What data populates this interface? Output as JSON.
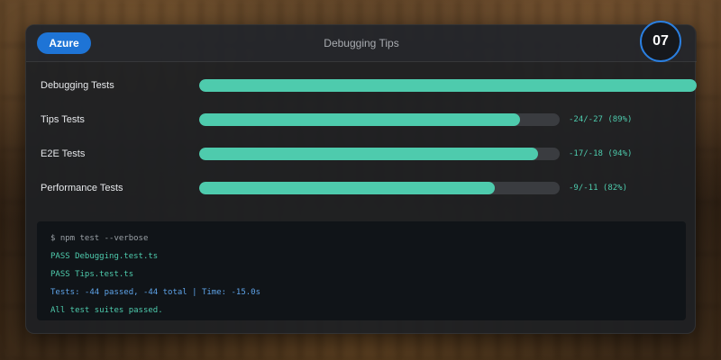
{
  "header": {
    "badge": "Azure",
    "title": "Debugging Tips",
    "step": "07"
  },
  "rows": [
    {
      "label": "Debugging Tests",
      "progress": 1.0,
      "stat": ""
    },
    {
      "label": "Tips Tests",
      "progress": 0.89,
      "stat": "-24/-27 (89%)"
    },
    {
      "label": "E2E Tests",
      "progress": 0.94,
      "stat": "-17/-18 (94%)"
    },
    {
      "label": "Performance Tests",
      "progress": 0.82,
      "stat": "-9/-11 (82%)"
    }
  ],
  "terminal": {
    "lines": [
      {
        "text": "$ npm test --verbose",
        "kind": "cmd"
      },
      {
        "text": "PASS Debugging.test.ts",
        "kind": "pass"
      },
      {
        "text": "PASS Tips.test.ts",
        "kind": "pass"
      },
      {
        "text": "Tests: -44 passed, -44 total | Time: -15.0s",
        "kind": "info"
      },
      {
        "text": "All test suites passed.",
        "kind": "pass"
      }
    ]
  },
  "colors": {
    "accent": "#4ecbad",
    "badge": "#1e74d6",
    "info": "#5ea3e8"
  }
}
